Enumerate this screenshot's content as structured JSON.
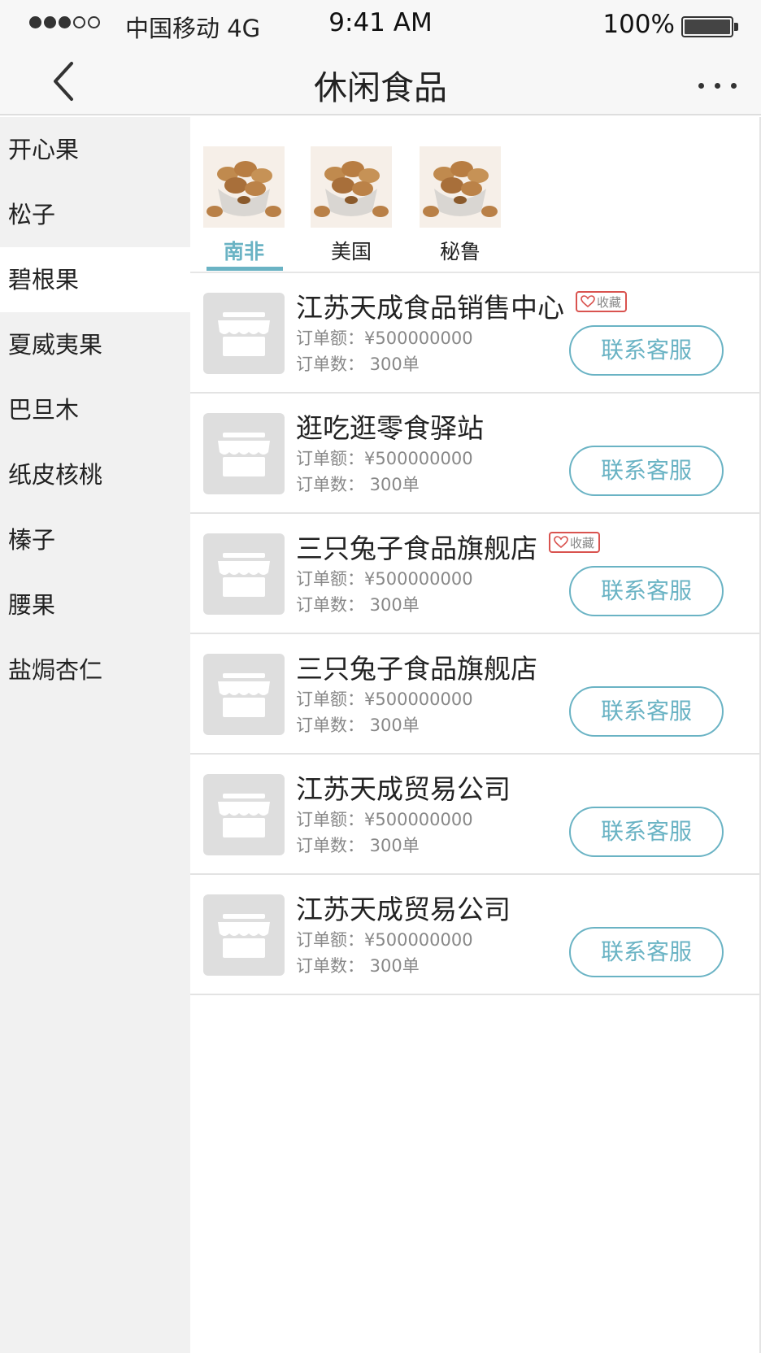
{
  "status_bar": {
    "carrier": "中国移动 4G",
    "time": "9:41 AM",
    "battery": "100%",
    "signal_bars_filled": 3,
    "signal_bars_total": 5
  },
  "nav": {
    "title": "休闲食品",
    "back_icon": "chevron-left-icon",
    "more_icon": "more-dots-icon"
  },
  "sidebar": {
    "items": [
      {
        "label": "开心果"
      },
      {
        "label": "松子"
      },
      {
        "label": "碧根果"
      },
      {
        "label": "夏威夷果"
      },
      {
        "label": "巴旦木"
      },
      {
        "label": "纸皮核桃"
      },
      {
        "label": "榛子"
      },
      {
        "label": "腰果"
      },
      {
        "label": "盐焗杏仁"
      }
    ],
    "active_index": 2
  },
  "origins": {
    "tabs": [
      {
        "label": "南非"
      },
      {
        "label": "美国"
      },
      {
        "label": "秘鲁"
      }
    ],
    "active_index": 0
  },
  "stores": [
    {
      "name": "江苏天成食品销售中心",
      "favorite": "收藏",
      "order_amount": "订单额：¥500000000",
      "order_count": "订单数：  300单",
      "contact": "联系客服"
    },
    {
      "name": "逛吃逛零食驿站",
      "favorite": "",
      "order_amount": "订单额：¥500000000",
      "order_count": "订单数：  300单",
      "contact": "联系客服"
    },
    {
      "name": "三只兔子食品旗舰店",
      "favorite": "收藏",
      "order_amount": "订单额：¥500000000",
      "order_count": "订单数：  300单",
      "contact": "联系客服"
    },
    {
      "name": "三只兔子食品旗舰店",
      "favorite": "",
      "order_amount": "订单额：¥500000000",
      "order_count": "订单数：  300单",
      "contact": "联系客服"
    },
    {
      "name": "江苏天成贸易公司",
      "favorite": "",
      "order_amount": "订单额：¥500000000",
      "order_count": "订单数：  300单",
      "contact": "联系客服"
    },
    {
      "name": "江苏天成贸易公司",
      "favorite": "",
      "order_amount": "订单额：¥500000000",
      "order_count": "订单数：  300单",
      "contact": "联系客服"
    }
  ],
  "colors": {
    "accent": "#6ab3c4",
    "favorite_border": "#d9534f",
    "sidebar_bg": "#f1f1f1",
    "placeholder_bg": "#dedede"
  }
}
